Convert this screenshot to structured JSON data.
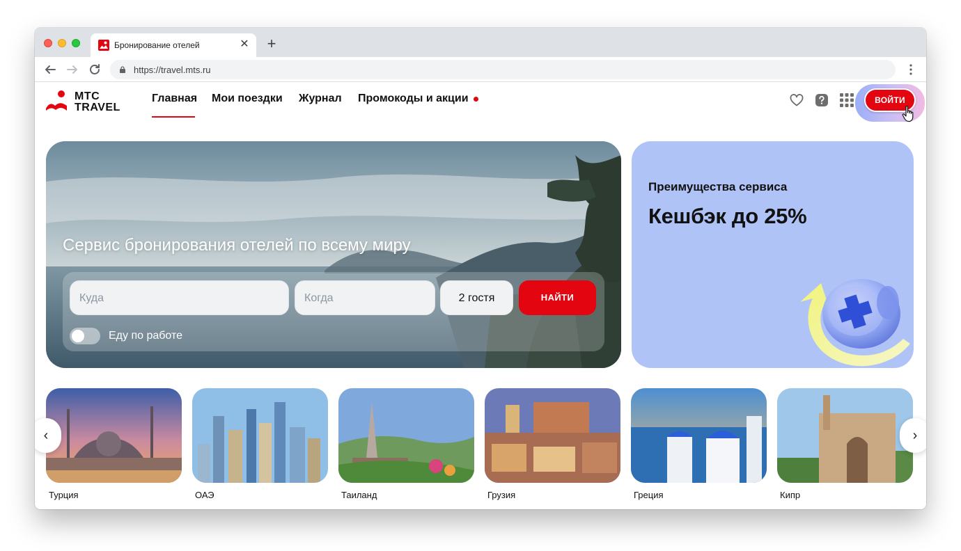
{
  "browser": {
    "tab_title": "Бронирование отелей",
    "tab_close": "✕",
    "new_tab": "+",
    "url": "https://travel.mts.ru",
    "icons": [
      "back-arrow-icon",
      "forward-arrow-icon",
      "reload-icon",
      "lock-icon",
      "more-menu-icon"
    ]
  },
  "header": {
    "logo_line1": "МТС",
    "logo_line2": "TRAVEL",
    "nav": [
      {
        "label": "Главная",
        "active": true
      },
      {
        "label": "Мои поездки"
      },
      {
        "label": "Журнал"
      },
      {
        "label": "Промокоды и акции",
        "badge": "dot"
      }
    ],
    "icons": [
      "heart-icon",
      "help-icon",
      "apps-grid-icon"
    ],
    "login_label": "ВОЙТИ",
    "accent_color": "#e30611"
  },
  "hero": {
    "title": "Сервис бронирования отелей по всему миру",
    "where_placeholder": "Куда",
    "when_placeholder": "Когда",
    "guests_value": "2 гостя",
    "find_label": "НАЙТИ",
    "work_trip_label": "Еду по работе",
    "work_trip_enabled": false
  },
  "promo": {
    "subtitle": "Преимущества сервиса",
    "title": "Кешбэк до 25%",
    "background": "#b0c3f7"
  },
  "destinations": [
    {
      "label": "Турция"
    },
    {
      "label": "ОАЭ"
    },
    {
      "label": "Таиланд"
    },
    {
      "label": "Грузия"
    },
    {
      "label": "Греция"
    },
    {
      "label": "Кипр"
    }
  ],
  "carousel": {
    "prev": "‹",
    "next": "›"
  }
}
